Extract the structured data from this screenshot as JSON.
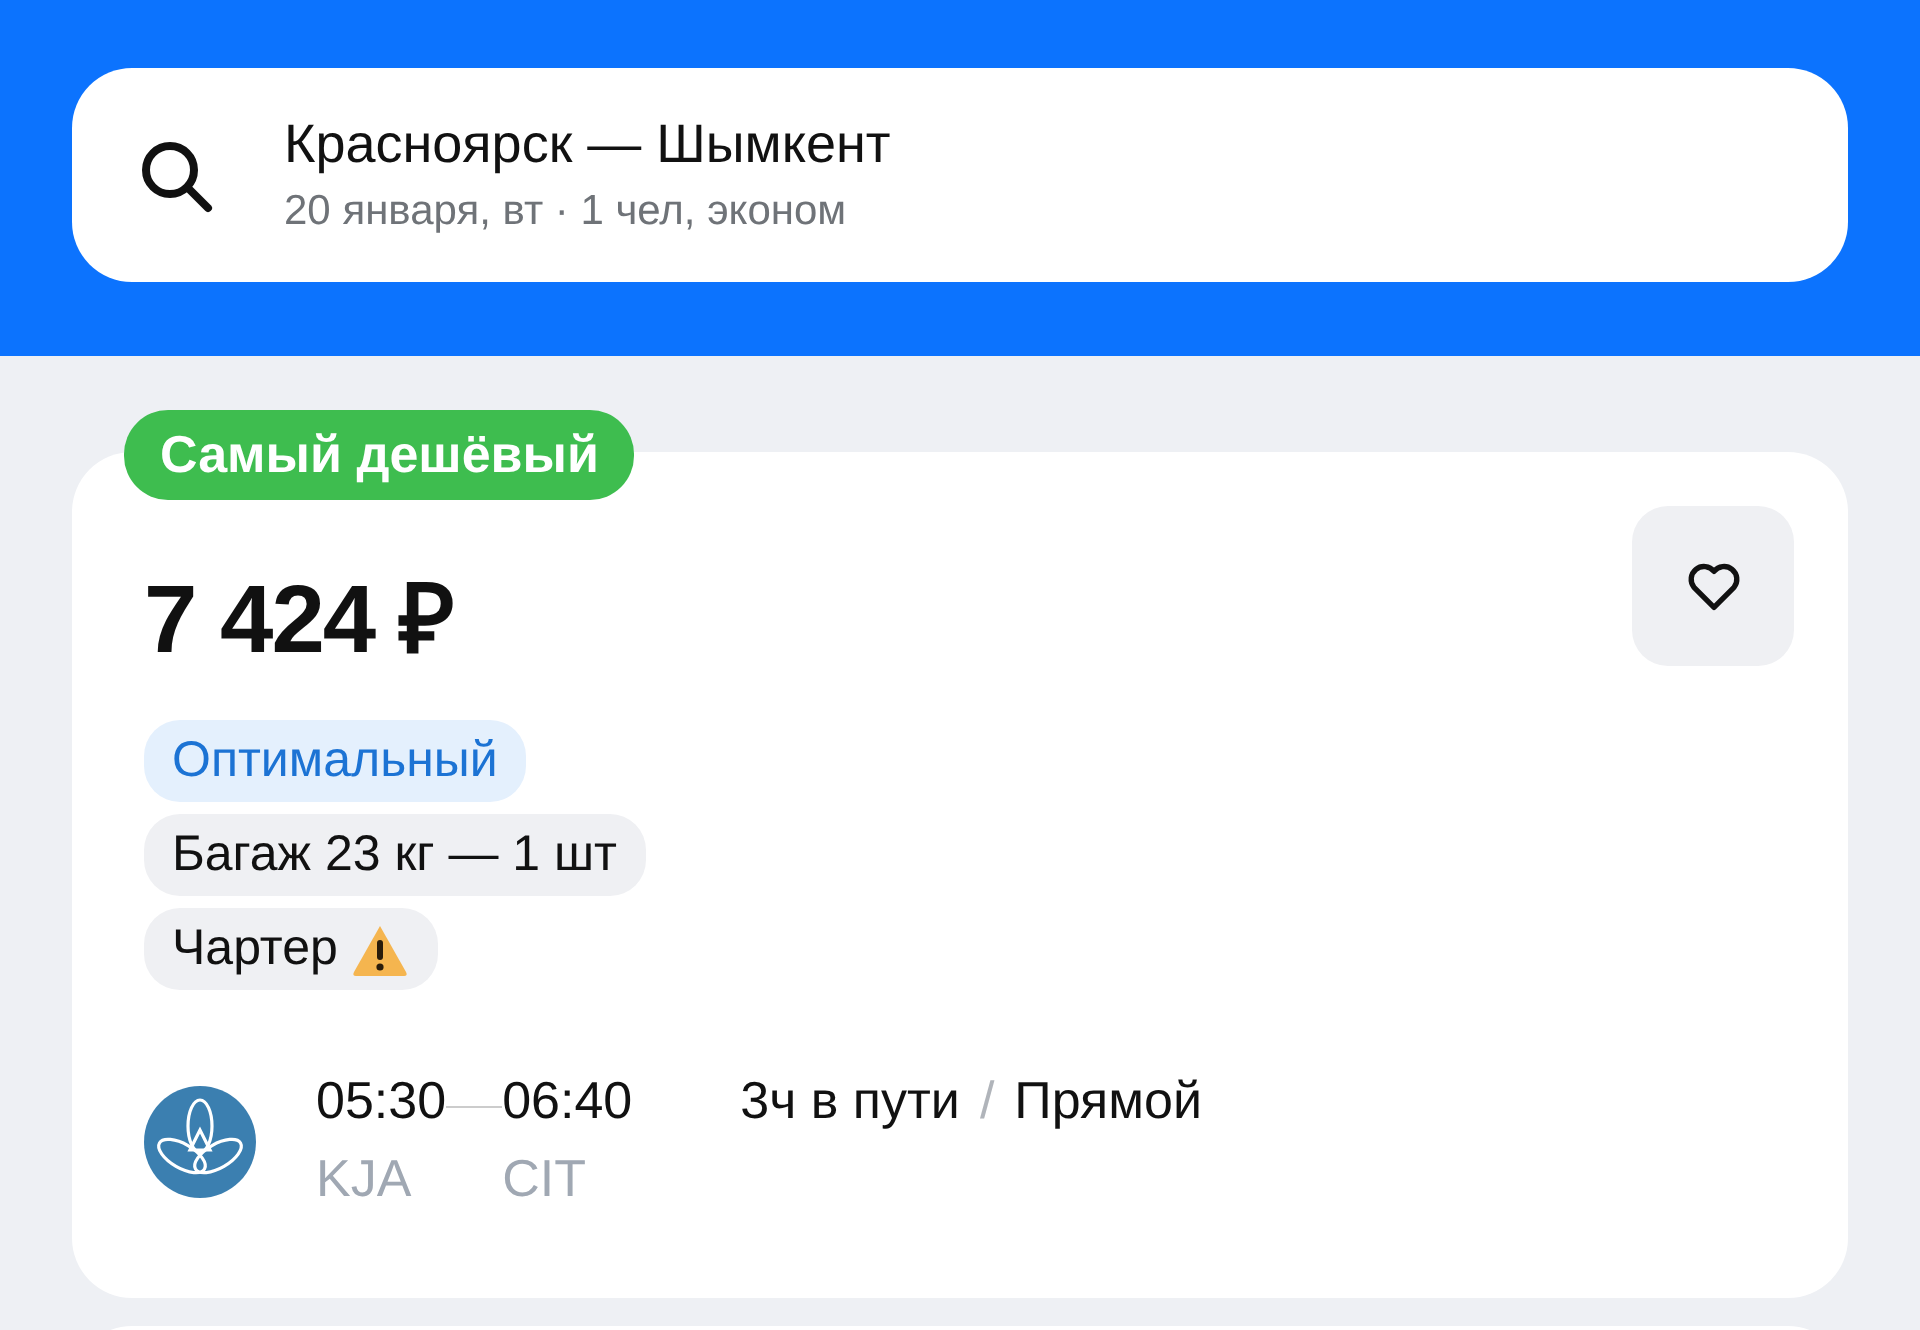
{
  "search": {
    "route": "Красноярск — Шымкент",
    "details": "20 января, вт · 1 чел, эконом"
  },
  "ticket": {
    "badge": "Самый дешёвый",
    "price": "7 424 ₽",
    "favorite": false,
    "tags": [
      {
        "kind": "highlight",
        "label": "Оптимальный"
      },
      {
        "kind": "plain",
        "label": "Багаж 23 кг — 1 шт"
      },
      {
        "kind": "warning",
        "label": "Чартер"
      }
    ],
    "flight": {
      "departure_time": "05:30",
      "arrival_time": "06:40",
      "departure_code": "KJA",
      "arrival_code": "CIT",
      "duration": "3ч в пути",
      "separator": "/",
      "stops": "Прямой"
    }
  }
}
